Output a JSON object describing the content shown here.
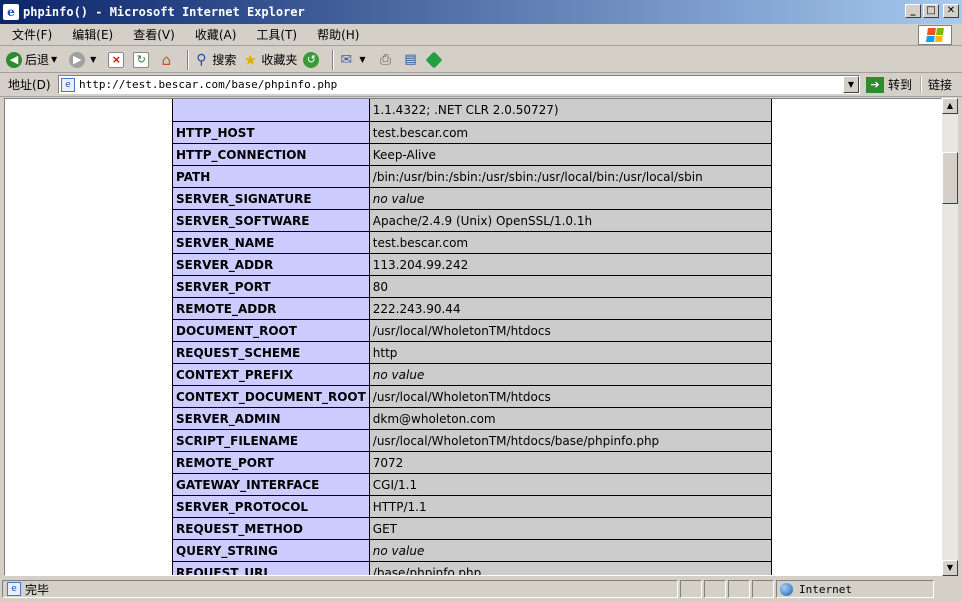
{
  "window": {
    "title": "phpinfo() - Microsoft Internet Explorer"
  },
  "menu": [
    "文件(F)",
    "编辑(E)",
    "查看(V)",
    "收藏(A)",
    "工具(T)",
    "帮助(H)"
  ],
  "toolbar": {
    "back_label": "后退",
    "search_label": "搜索",
    "favorites_label": "收藏夹"
  },
  "address": {
    "label": "地址(D)",
    "url": "http://test.bescar.com/base/phpinfo.php",
    "go_label": "转到",
    "links_label": "链接"
  },
  "table": {
    "first_row_value": "1.1.4322; .NET CLR 2.0.50727)",
    "rows": [
      {
        "name": "HTTP_HOST",
        "value": "test.bescar.com"
      },
      {
        "name": "HTTP_CONNECTION",
        "value": "Keep-Alive"
      },
      {
        "name": "PATH",
        "value": "/bin:/usr/bin:/sbin:/usr/sbin:/usr/local/bin:/usr/local/sbin"
      },
      {
        "name": "SERVER_SIGNATURE",
        "value": "no value"
      },
      {
        "name": "SERVER_SOFTWARE",
        "value": "Apache/2.4.9 (Unix) OpenSSL/1.0.1h"
      },
      {
        "name": "SERVER_NAME",
        "value": "test.bescar.com"
      },
      {
        "name": "SERVER_ADDR",
        "value": "113.204.99.242"
      },
      {
        "name": "SERVER_PORT",
        "value": "80"
      },
      {
        "name": "REMOTE_ADDR",
        "value": "222.243.90.44"
      },
      {
        "name": "DOCUMENT_ROOT",
        "value": "/usr/local/WholetonTM/htdocs"
      },
      {
        "name": "REQUEST_SCHEME",
        "value": "http"
      },
      {
        "name": "CONTEXT_PREFIX",
        "value": "no value"
      },
      {
        "name": "CONTEXT_DOCUMENT_ROOT",
        "value": "/usr/local/WholetonTM/htdocs"
      },
      {
        "name": "SERVER_ADMIN",
        "value": "dkm@wholeton.com"
      },
      {
        "name": "SCRIPT_FILENAME",
        "value": "/usr/local/WholetonTM/htdocs/base/phpinfo.php"
      },
      {
        "name": "REMOTE_PORT",
        "value": "7072"
      },
      {
        "name": "GATEWAY_INTERFACE",
        "value": "CGI/1.1"
      },
      {
        "name": "SERVER_PROTOCOL",
        "value": "HTTP/1.1"
      },
      {
        "name": "REQUEST_METHOD",
        "value": "GET"
      },
      {
        "name": "QUERY_STRING",
        "value": "no value"
      },
      {
        "name": "REQUEST_URI",
        "value": "/base/phpinfo.php"
      }
    ]
  },
  "status": {
    "text": "完毕",
    "zone": "Internet"
  }
}
